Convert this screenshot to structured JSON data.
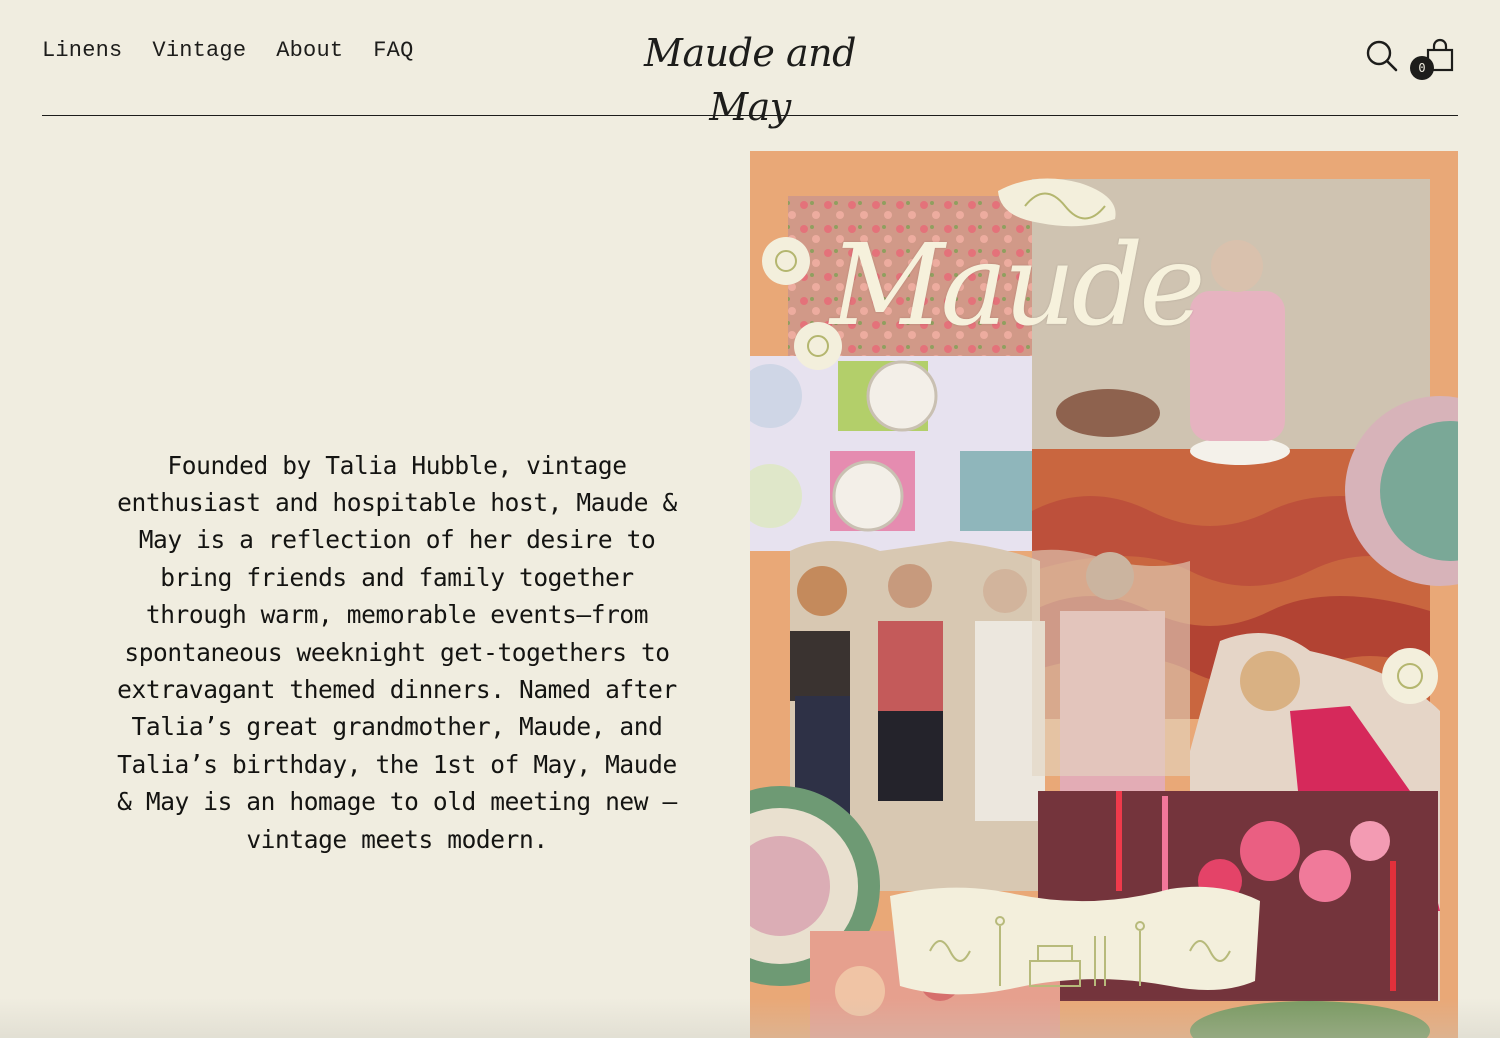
{
  "nav": {
    "items": [
      {
        "label": "Linens"
      },
      {
        "label": "Vintage"
      },
      {
        "label": "About"
      },
      {
        "label": "FAQ"
      }
    ]
  },
  "brand": {
    "logo_text": "Maude and May"
  },
  "header_icons": {
    "search": "search-icon",
    "cart": "shopping-bag-icon",
    "cart_count": "0"
  },
  "story": {
    "text": "Founded by Talia Hubble, vintage enthusiast and hospitable host, Maude & May is a reflection of her desire to bring friends and family together through warm, memorable events—from spontaneous weeknight get-togethers to extravagant themed dinners. Named after Talia’s great grandmother, Maude, and Talia’s birthday, the 1st of May, Maude & May is an homage to old meeting new — vintage meets modern."
  },
  "collage": {
    "title_text": "Maude"
  },
  "colors": {
    "background": "#f0ede0",
    "text": "#1d1d1b",
    "collage_background": "#e9a877"
  }
}
